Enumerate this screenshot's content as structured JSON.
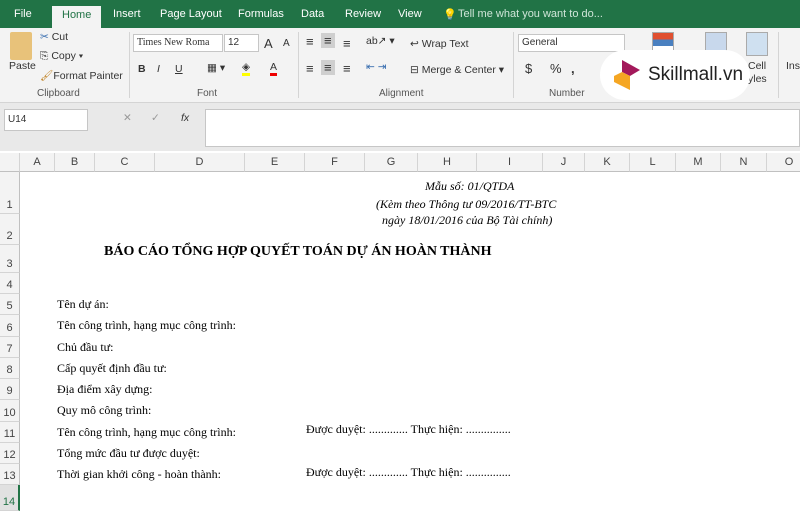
{
  "ribbon": {
    "tabs": [
      "File",
      "Home",
      "Insert",
      "Page Layout",
      "Formulas",
      "Data",
      "Review",
      "View"
    ],
    "active_tab": "Home",
    "tell_me": "Tell me what you want to do...",
    "clipboard": {
      "paste": "Paste",
      "cut": "Cut",
      "copy": "Copy",
      "format_painter": "Format Painter",
      "label": "Clipboard"
    },
    "font": {
      "name": "Times New Roma",
      "size": "12",
      "bold": "B",
      "italic": "I",
      "underline": "U",
      "label": "Font"
    },
    "alignment": {
      "wrap": "Wrap Text",
      "merge": "Merge & Center",
      "label": "Alignment"
    },
    "number": {
      "format": "General",
      "currency": "$",
      "percent": "%",
      "comma": ",",
      "label": "Number"
    },
    "styles": {
      "cell": "Cell",
      "styles": "yles"
    },
    "insert": "Ins"
  },
  "watermark": {
    "text": "Skillmall.vn",
    "colors": [
      "#a3195b",
      "#f5a623"
    ]
  },
  "formula_bar": {
    "name_box": "U14",
    "fx": "fx",
    "value": ""
  },
  "columns": [
    "A",
    "B",
    "C",
    "D",
    "E",
    "F",
    "G",
    "H",
    "I",
    "J",
    "K",
    "L",
    "M",
    "N",
    "O"
  ],
  "rows": [
    "1",
    "2",
    "3",
    "4",
    "5",
    "6",
    "7",
    "8",
    "9",
    "10",
    "11",
    "12",
    "13",
    "14"
  ],
  "selected_row": "14",
  "sheet": {
    "form_no": "Mẫu số: 01/QTDA",
    "attach": "(Kèm theo Thông tư 09/2016/TT-BTC",
    "date": "ngày 18/01/2016 của Bộ Tài chính)",
    "title": "BÁO CÁO TỔNG HỢP QUYẾT TOÁN DỰ ÁN HOÀN THÀNH",
    "labels": [
      "Tên dự án:",
      "Tên công trình, hạng mục công trình:",
      "Chủ đầu tư:",
      "Cấp quyết định đầu tư:",
      "Địa điểm xây dựng:",
      "Quy mô công trình:",
      "Tên công trình, hạng mục công trình:",
      "Tổng mức đầu tư được duyệt:",
      "Thời gian khởi công - hoàn thành:"
    ],
    "approved_11": "Được duyệt: ............. Thực hiện: ...............",
    "approved_13": "Được duyệt: ............. Thực hiện: ..............."
  },
  "accent": "#217346"
}
